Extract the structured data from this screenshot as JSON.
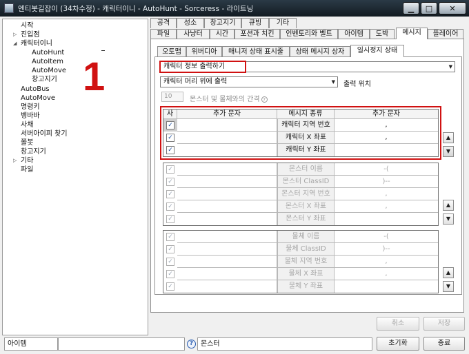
{
  "window": {
    "title": "엔티봇길잡이 (34차수정) - 캐릭터이니 - AutoHunt - Sorceress - 라이트닝",
    "minimize_glyph": "▁",
    "maximize_glyph": "□",
    "close_glyph": "✕"
  },
  "tree": {
    "items": [
      {
        "label": "시작"
      },
      {
        "label": "진입점"
      },
      {
        "label": "캐릭터이니"
      },
      {
        "label": "AutoHunt"
      },
      {
        "label": "AutoItem"
      },
      {
        "label": "AutoMove"
      },
      {
        "label": "창고지기"
      },
      {
        "label": "AutoBus"
      },
      {
        "label": "AutoMove"
      },
      {
        "label": "명령키"
      },
      {
        "label": "벵바바"
      },
      {
        "label": "사채"
      },
      {
        "label": "서버아이피 찾기"
      },
      {
        "label": "쫄봇"
      },
      {
        "label": "창고지기"
      },
      {
        "label": "기타"
      },
      {
        "label": "파일"
      }
    ]
  },
  "annotation": {
    "number": "1"
  },
  "tabs_row1": [
    {
      "label": "공격"
    },
    {
      "label": "성소"
    },
    {
      "label": "창고지기"
    },
    {
      "label": "큐빙"
    },
    {
      "label": "기타"
    }
  ],
  "tabs_row2": [
    {
      "label": "파일"
    },
    {
      "label": "사냥터"
    },
    {
      "label": "시간"
    },
    {
      "label": "포션과 치킨"
    },
    {
      "label": "인벤토리와 벨트"
    },
    {
      "label": "아이템"
    },
    {
      "label": "도박"
    },
    {
      "label": "메시지",
      "active": true
    },
    {
      "label": "플레이어"
    }
  ],
  "subtabs": [
    {
      "label": "오토맵"
    },
    {
      "label": "위버디아"
    },
    {
      "label": "매니저 상태 표시줄"
    },
    {
      "label": "상태 메시지 상자"
    },
    {
      "label": "일시정지 상태",
      "active": true
    }
  ],
  "message_settings": {
    "output_mode": "캐릭터 정보 출력하기",
    "position_value": "캐릭터 머리 위에 출력",
    "position_label": "출력 위치",
    "spacing_value": "10",
    "spacing_label": "몬스터 및 물체와의 간격",
    "help_glyph": "?"
  },
  "character_grid": {
    "headers": {
      "use": "사",
      "prefix": "추가 문자",
      "type": "메시지 종류",
      "suffix": "추가 문자"
    },
    "rows": [
      {
        "checked": "✓",
        "prefix": "",
        "type": "캐릭터 지역 번호",
        "suffix": ","
      },
      {
        "checked": "✓",
        "prefix": "",
        "type": "캐릭터 X 좌표",
        "suffix": ","
      },
      {
        "checked": "✓",
        "prefix": "",
        "type": "캐릭터 Y 좌표",
        "suffix": ""
      }
    ]
  },
  "monster_grid": {
    "rows": [
      {
        "checked": "✓",
        "prefix": "",
        "type": "몬스터 이름",
        "suffix": "-("
      },
      {
        "checked": "✓",
        "prefix": "",
        "type": "몬스터 ClassID",
        "suffix": ")--"
      },
      {
        "checked": "✓",
        "prefix": "",
        "type": "몬스터 지역 번호",
        "suffix": ","
      },
      {
        "checked": "✓",
        "prefix": "",
        "type": "몬스터 X 좌표",
        "suffix": ","
      },
      {
        "checked": "✓",
        "prefix": "",
        "type": "몬스터 Y 좌표",
        "suffix": ""
      }
    ]
  },
  "object_grid": {
    "rows": [
      {
        "checked": "✓",
        "prefix": "",
        "type": "물체 이름",
        "suffix": "-("
      },
      {
        "checked": "✓",
        "prefix": "",
        "type": "물체 ClassID",
        "suffix": ")--"
      },
      {
        "checked": "✓",
        "prefix": "",
        "type": "물체 지역 번호",
        "suffix": ","
      },
      {
        "checked": "✓",
        "prefix": "",
        "type": "물체 X 좌표",
        "suffix": ","
      },
      {
        "checked": "✓",
        "prefix": "",
        "type": "물체 Y 좌표",
        "suffix": ""
      }
    ]
  },
  "scroll_glyphs": {
    "up": "▲",
    "down": "▼"
  },
  "buttons": {
    "cancel": "취소",
    "save": "저장",
    "reset": "초기화",
    "exit": "종료"
  },
  "status_bar": {
    "left": "아이템",
    "help_glyph": "?",
    "middle": "몬스터"
  }
}
